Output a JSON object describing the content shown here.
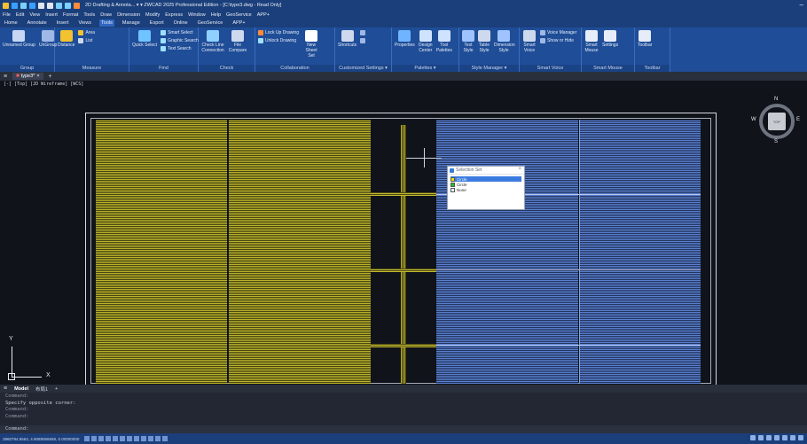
{
  "titlebar": {
    "title": "2D Drafting & Annota...  ▾  ▾   ZWCAD 2025 Professional Edition - [C:\\type3.dwg - Read Only]"
  },
  "menu": [
    "File",
    "Edit",
    "View",
    "Insert",
    "Format",
    "Tools",
    "Draw",
    "Dimension",
    "Modify",
    "Express",
    "Window",
    "Help",
    "GeoService",
    "APP+"
  ],
  "tabs": [
    {
      "label": "Home",
      "active": false
    },
    {
      "label": "Annotate",
      "active": false
    },
    {
      "label": "Insert",
      "active": false
    },
    {
      "label": "Views",
      "active": false
    },
    {
      "label": "Tools",
      "active": true
    },
    {
      "label": "Manage",
      "active": false
    },
    {
      "label": "Export",
      "active": false
    },
    {
      "label": "Online",
      "active": false
    },
    {
      "label": "GeoService",
      "active": false
    },
    {
      "label": "APP+",
      "active": false
    }
  ],
  "ribbon": {
    "group": {
      "label": "Group",
      "unnamed": "Unnamed Group",
      "ungroup": "UnGroup"
    },
    "measure": {
      "label": "Measure",
      "distance": "Distance",
      "area": "Area",
      "list": "List"
    },
    "find": {
      "label": "Find",
      "quick_select": "Quick Select",
      "smart_select": "Smart Select",
      "graphic_search": "Graphic Search",
      "text_search": "Text Search"
    },
    "check": {
      "label": "Check",
      "check_line": "Check Line Connection",
      "file_compare": "File Compare"
    },
    "collab": {
      "label": "Collaboration",
      "lock_up": "Lock Up Drawing",
      "unlock": "Unlock Drawing",
      "new_sheet": "New Sheet Set"
    },
    "custom": {
      "label": "Customized Settings ▾",
      "shortcuts": "Shortcuts"
    },
    "palettes": {
      "label": "Palettes ▾",
      "properties": "Properties",
      "design_center": "Design Center",
      "tool_palettes": "Tool Palettes"
    },
    "style": {
      "label": "Style Manager ▾",
      "text_style": "Text Style",
      "table_style": "Table Style",
      "dim_style": "Dimension Style"
    },
    "voice": {
      "label": "Smart Voice",
      "smart_voice": "Smart Voice",
      "voice_manager": "Voice Manager",
      "show_hide": "Show or Hide"
    },
    "mouse": {
      "label": "Smart Mouse",
      "smart_mouse": "Smart Mouse",
      "settings": "Settings"
    },
    "toolbar": {
      "label": "Toolbar",
      "toolbar": "Toolbar"
    }
  },
  "doc": {
    "tab_label": "type3*",
    "close": "×",
    "add": "+"
  },
  "viewport": {
    "label": "[-] [Top] [2D Wireframe] [WCS]"
  },
  "navcube": {
    "top": "TOP",
    "n": "N",
    "s": "S",
    "e": "E",
    "w": "W"
  },
  "ucs": {
    "x": "X",
    "y": "Y"
  },
  "selection_set": {
    "title": "Selection Set",
    "close": "×",
    "items": [
      {
        "label": "Circle",
        "color": "#f0e000",
        "highlight": true
      },
      {
        "label": "Circle",
        "color": "#22c322",
        "highlight": false
      },
      {
        "label": "None",
        "color": "#ffffff",
        "highlight": false
      }
    ]
  },
  "layout_tabs": [
    {
      "label": "Model",
      "active": true
    },
    {
      "label": "布局1",
      "active": false
    },
    {
      "label": "+",
      "active": false
    }
  ],
  "command": {
    "history": [
      "Command:",
      "Specify opposite corner:",
      "Command:",
      "Command:"
    ],
    "input": "Command:"
  },
  "status": {
    "coords": "3960794.8563, 4.9089066659, 0.00000000"
  },
  "colors": {
    "yellow": "#b9b22a",
    "blue": "#5a7fcf",
    "title_blue": "#1b3f7a"
  }
}
